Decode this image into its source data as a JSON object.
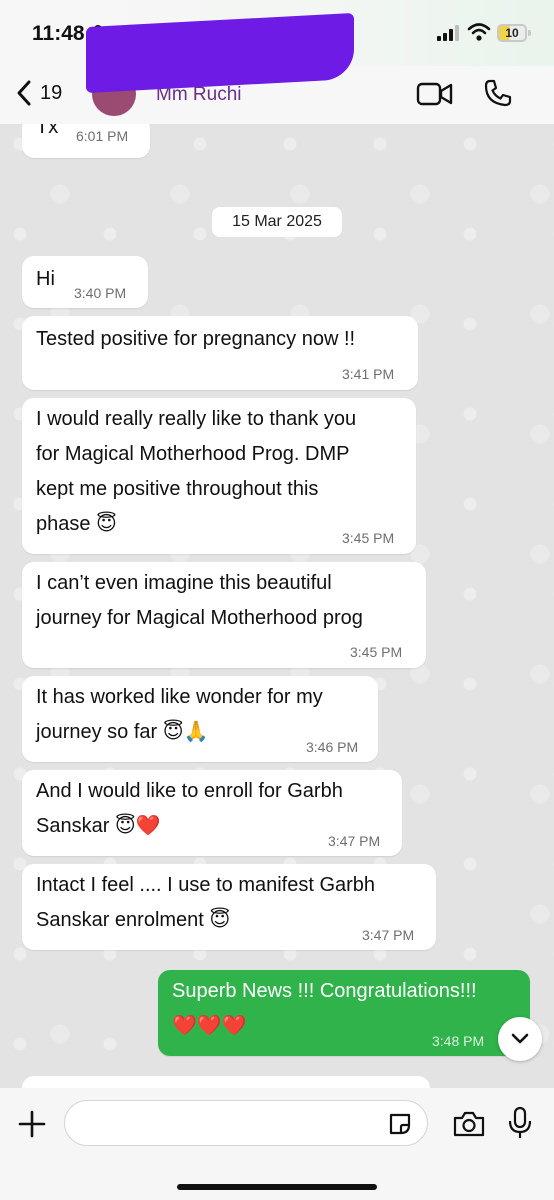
{
  "status_bar": {
    "time": "11:48",
    "battery": "10"
  },
  "header": {
    "back_count": "19",
    "contact_name": "Mm Ruchi"
  },
  "chat": {
    "date_separator": "15 Mar 2025",
    "messages": [
      {
        "lines": [
          "Tx"
        ],
        "time": "6:01 PM"
      },
      {
        "lines": [
          "Hi"
        ],
        "time": "3:40 PM"
      },
      {
        "lines": [
          "Tested positive for pregnancy now !!"
        ],
        "time": "3:41 PM"
      },
      {
        "lines": [
          "I would really really like to thank you",
          "for Magical Motherhood Prog. DMP",
          "kept me positive throughout this",
          "phase 😇"
        ],
        "time": "3:45 PM"
      },
      {
        "lines": [
          "I can’t even imagine this beautiful",
          "journey for Magical Motherhood prog"
        ],
        "time": "3:45 PM"
      },
      {
        "lines": [
          "It has worked like wonder for my",
          "journey so far 😇🙏"
        ],
        "time": "3:46 PM"
      },
      {
        "lines": [
          "And I would like to enroll for Garbh",
          "Sanskar 😇❤️"
        ],
        "time": "3:47 PM"
      },
      {
        "lines": [
          "Intact I feel .... I use to manifest Garbh",
          "Sanskar enrolment 😇"
        ],
        "time": "3:47 PM"
      },
      {
        "lines": [
          "Superb News !!! Congratulations!!!",
          "❤️❤️❤️"
        ],
        "time": "3:48 PM"
      }
    ]
  },
  "input": {
    "placeholder": ""
  },
  "colors": {
    "outgoing_bubble": "#2fb34a",
    "incoming_bubble": "#ffffff",
    "redaction": "#6d1be5"
  }
}
